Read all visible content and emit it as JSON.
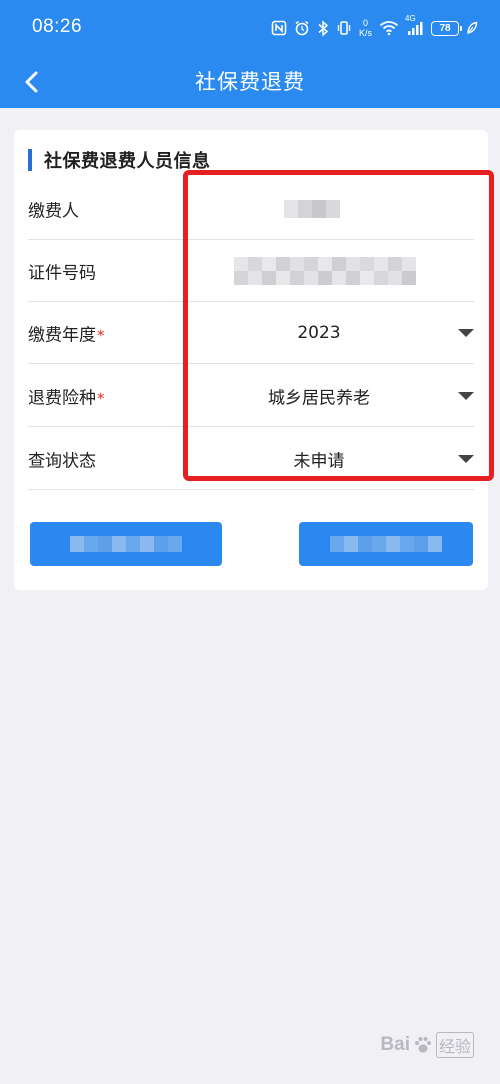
{
  "status_bar": {
    "time": "08:26",
    "net_speed_value": "0",
    "net_speed_unit": "K/s",
    "network_type": "4G",
    "battery_level": "78"
  },
  "header": {
    "title": "社保费退费",
    "back_icon": "chevron-left-icon"
  },
  "section": {
    "title": "社保费退费人员信息"
  },
  "form": {
    "payer": {
      "label": "缴费人",
      "value": ""
    },
    "id_number": {
      "label": "证件号码",
      "value": ""
    },
    "payment_year": {
      "label": "缴费年度",
      "required_mark": "*",
      "value": "2023"
    },
    "insurance_type": {
      "label": "退费险种",
      "required_mark": "*",
      "value": "城乡居民养老"
    },
    "query_status": {
      "label": "查询状态",
      "value": "未申请"
    }
  },
  "buttons": {
    "left_label": "",
    "right_label": ""
  },
  "watermark": {
    "brand": "Bai",
    "suffix": "经验"
  },
  "colors": {
    "primary_blue": "#2a8af0",
    "section_bar": "#2a6fd6",
    "required_red": "#e03030",
    "highlight_red": "#e62020",
    "background": "#f0f0f5"
  }
}
